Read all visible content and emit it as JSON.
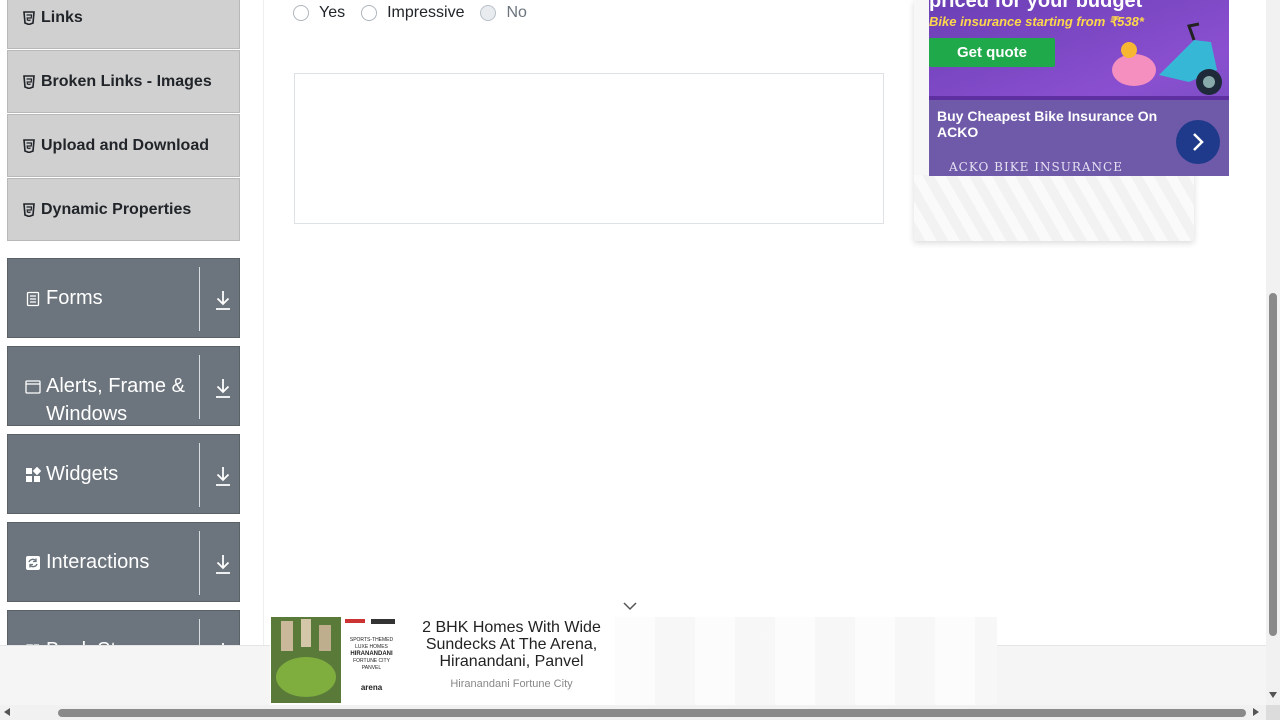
{
  "sidebar": {
    "sub_items": [
      {
        "label": "Links",
        "icon": "html5-icon"
      },
      {
        "label": "Broken Links - Images",
        "icon": "html5-icon"
      },
      {
        "label": "Upload and Download",
        "icon": "html5-icon"
      },
      {
        "label": "Dynamic Properties",
        "icon": "html5-icon"
      }
    ],
    "groups": [
      {
        "label": "Forms",
        "icon": "document-icon"
      },
      {
        "label": "Alerts, Frame & Windows",
        "icon": "window-icon"
      },
      {
        "label": "Widgets",
        "icon": "grid-icon"
      },
      {
        "label": "Interactions",
        "icon": "refresh-icon"
      },
      {
        "label": "Book Store",
        "icon": "book-icon"
      }
    ]
  },
  "radio_group": {
    "options": [
      {
        "label": "Yes",
        "disabled": false
      },
      {
        "label": "Impressive",
        "disabled": false
      },
      {
        "label": "No",
        "disabled": true
      }
    ]
  },
  "side_ad": {
    "headline": "priced for your budget",
    "subline": "Bike insurance starting from ₹538*",
    "cta": "Get quote",
    "title": "Buy Cheapest Bike Insurance On ACKO",
    "brand": "ACKO BIKE INSURANCE",
    "colors": {
      "bg": "#7b48c4",
      "cta": "#1fa94a",
      "arrow": "#1f3a8a"
    }
  },
  "bottom_ad": {
    "title": "2 BHK Homes With Wide Sundecks At The Arena, Hiranandani, Panvel",
    "brand": "Hiranandani Fortune City",
    "thumb_text": [
      "SPORTS-THEMED",
      "LUXE HOMES",
      "HIRANANDANI",
      "FORTUNE CITY",
      "PANVEL",
      "arena"
    ]
  },
  "colors": {
    "sidebar_group": "#6c757d",
    "sidebar_item": "#d0d0d0"
  }
}
